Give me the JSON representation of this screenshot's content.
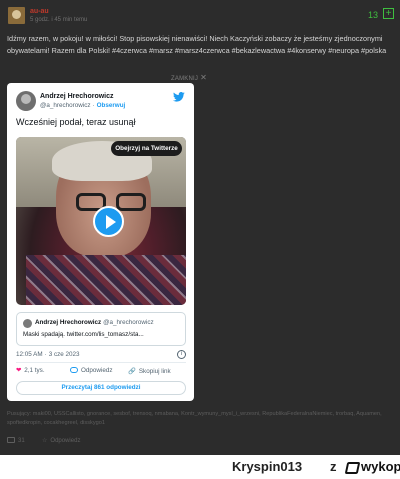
{
  "post": {
    "author": "au-au",
    "time": "5 godz. i 45 min temu",
    "score": "13",
    "vote_plus_icon": "plus-square-icon",
    "body": "Idźmy razem, w pokoju! w miłości! Stop pisowskiej nienawiści! Niech Kaczyński zobaczy że jesteśmy zjednoczonymi obywatelami! Razem dla Polski! #4czerwca #marsz #marsz4czerwca #bekazlewactwa #4konserwy #neuropa #polska",
    "close_label": "ZAMKNIJ",
    "close_icon": "close-icon",
    "tags": "Pusujący: maki00, USSCallisto, gnorance, sesbof, trensoq, nmabana, Kontr_wymuny_mysl_i_wrzesni, RepublikaFederalnaNiemiec, trorbaq, Aquamen, spoftedkropin, cocakhegreel, disskygo1",
    "reply_count": "31",
    "favorite_label": "Odpowiedz",
    "accent_green": "#3fbf3f",
    "author_color": "#c0392b"
  },
  "tweet": {
    "author_name": "Andrzej Hrechorowicz",
    "handle": "@a_hrechorowicz",
    "separator": "·",
    "follow_label": "Obserwuj",
    "text": "Wcześniej podał, teraz usunął",
    "watch_label": "Obejrzyj na Twitterze",
    "quote": {
      "name": "Andrzej Hrechorowicz",
      "handle": "@a_hrechorowicz",
      "text": "Maski spadają. twitter.com/lis_tomasz/sta..."
    },
    "time": "12:05 AM",
    "dot": "·",
    "date": "3 cze 2023",
    "info_label": "i",
    "likes": "2,1 tys.",
    "reply_label": "Odpowiedz",
    "copy_link_label": "Skopiuj link",
    "read_replies_label": "Przeczytaj 861 odpowiedzi",
    "brand_color": "#1d9bf0",
    "like_color": "#f91880"
  },
  "watermark": {
    "user": "Kryspin013",
    "separator": "z",
    "site": "wykop.pl"
  }
}
